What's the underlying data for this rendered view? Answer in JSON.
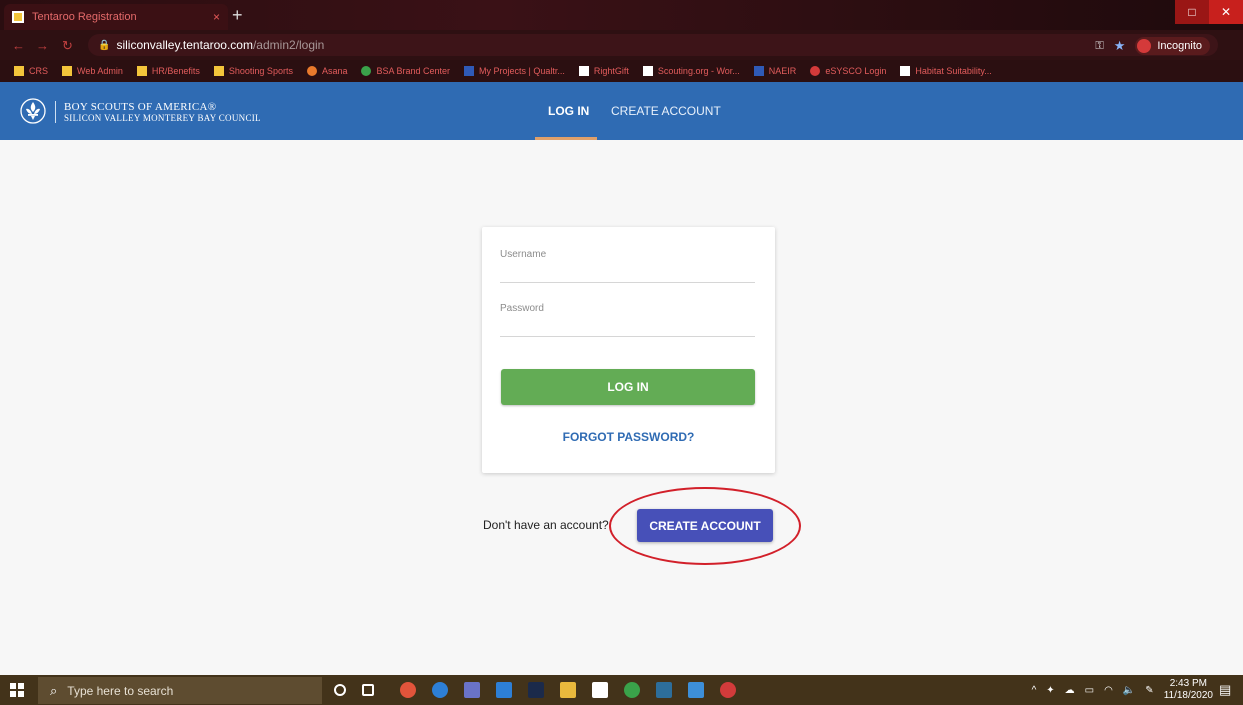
{
  "browser": {
    "tab_title": "Tentaroo Registration",
    "tab_close": "×",
    "new_tab": "+",
    "url_host": "siliconvalley.tentaroo.com",
    "url_path": "/admin2/login",
    "incognito_label": "Incognito",
    "window": {
      "minimize": "—",
      "maximize": "□",
      "close": "✕"
    }
  },
  "bookmarks": [
    {
      "label": "CRS",
      "icon": "folder-icon"
    },
    {
      "label": "Web Admin",
      "icon": "folder-icon"
    },
    {
      "label": "HR/Benefits",
      "icon": "folder-icon"
    },
    {
      "label": "Shooting Sports",
      "icon": "folder-icon"
    },
    {
      "label": "Asana",
      "icon": "asana-icon"
    },
    {
      "label": "BSA Brand Center",
      "icon": "globe-icon"
    },
    {
      "label": "My Projects | Qualtr...",
      "icon": "xm-icon"
    },
    {
      "label": "RightGift",
      "icon": "gift-icon"
    },
    {
      "label": "Scouting.org - Wor...",
      "icon": "scouting-icon"
    },
    {
      "label": "NAEIR",
      "icon": "naeir-icon"
    },
    {
      "label": "eSYSCO Login",
      "icon": "sysco-icon"
    },
    {
      "label": "Habitat Suitability...",
      "icon": "habitat-icon"
    }
  ],
  "site": {
    "org_line1": "BOY SCOUTS OF AMERICA®",
    "org_line2": "SILICON VALLEY MONTEREY BAY COUNCIL",
    "nav_login": "LOG IN",
    "nav_create": "CREATE ACCOUNT"
  },
  "login": {
    "username_label": "Username",
    "password_label": "Password",
    "login_button": "LOG IN",
    "forgot_link": "FORGOT PASSWORD?",
    "no_account_text": "Don't have an account?",
    "create_button": "CREATE ACCOUNT"
  },
  "taskbar": {
    "search_placeholder": "Type here to search",
    "time": "2:43 PM",
    "date": "11/18/2020"
  },
  "colors": {
    "header_blue": "#2f6bb3",
    "login_green": "#63ac55",
    "create_indigo": "#4750b8",
    "annotation_red": "#d2202a"
  }
}
